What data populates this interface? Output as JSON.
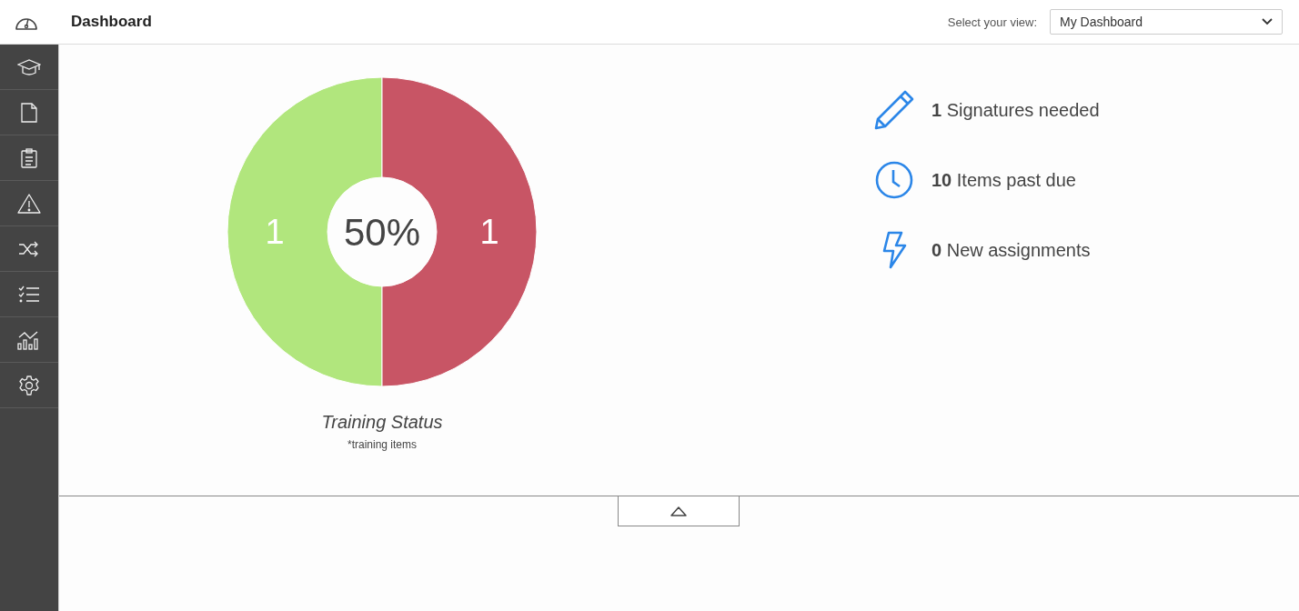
{
  "header": {
    "title": "Dashboard",
    "view_label": "Select your view:",
    "view_select": {
      "value": "My Dashboard"
    }
  },
  "sidebar": {
    "items": [
      {
        "kind": "graduation-cap"
      },
      {
        "kind": "document"
      },
      {
        "kind": "clipboard"
      },
      {
        "kind": "warning"
      },
      {
        "kind": "shuffle"
      },
      {
        "kind": "checklist"
      },
      {
        "kind": "chart"
      },
      {
        "kind": "gear"
      }
    ]
  },
  "training_chart": {
    "center_label": "50%",
    "title": "Training Status",
    "note": "*training items",
    "slices": [
      {
        "label": "1",
        "color": "#b1e67d"
      },
      {
        "label": "1",
        "color": "#c85565"
      }
    ],
    "chart_data": {
      "type": "donut",
      "values": [
        1,
        1
      ],
      "data_labels": true
    }
  },
  "stats": [
    {
      "kind": "pencil",
      "count": "1",
      "label": "Signatures needed"
    },
    {
      "kind": "clock",
      "count": "10",
      "label": "Items past due"
    },
    {
      "kind": "lightning",
      "count": "0",
      "label": "New assignments"
    }
  ]
}
